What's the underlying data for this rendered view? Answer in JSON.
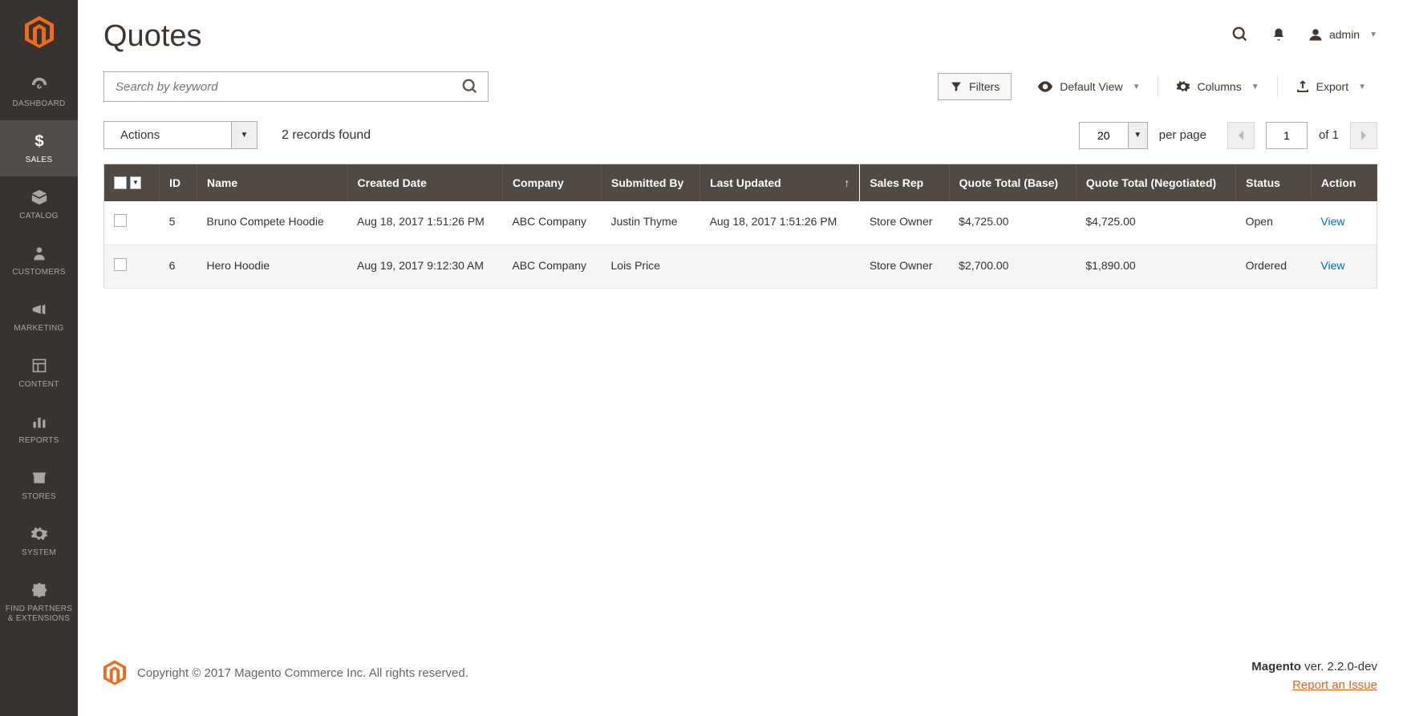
{
  "header": {
    "title": "Quotes",
    "user_label": "admin"
  },
  "sidebar": {
    "items": [
      {
        "label": "DASHBOARD"
      },
      {
        "label": "SALES"
      },
      {
        "label": "CATALOG"
      },
      {
        "label": "CUSTOMERS"
      },
      {
        "label": "MARKETING"
      },
      {
        "label": "CONTENT"
      },
      {
        "label": "REPORTS"
      },
      {
        "label": "STORES"
      },
      {
        "label": "SYSTEM"
      },
      {
        "label": "FIND PARTNERS & EXTENSIONS"
      }
    ]
  },
  "search": {
    "placeholder": "Search by keyword"
  },
  "controls": {
    "filters": "Filters",
    "default_view": "Default View",
    "columns": "Columns",
    "export": "Export"
  },
  "actions": {
    "label": "Actions"
  },
  "records_found": "2 records found",
  "pagination": {
    "per_page_value": "20",
    "per_page_label": "per page",
    "page_value": "1",
    "of_label": "of 1"
  },
  "table": {
    "headers": {
      "id": "ID",
      "name": "Name",
      "created": "Created Date",
      "company": "Company",
      "submitted": "Submitted By",
      "updated": "Last Updated",
      "sales_rep": "Sales Rep",
      "total_base": "Quote Total (Base)",
      "total_neg": "Quote Total (Negotiated)",
      "status": "Status",
      "action": "Action"
    },
    "rows": [
      {
        "id": "5",
        "name": "Bruno Compete Hoodie",
        "created": "Aug 18, 2017 1:51:26 PM",
        "company": "ABC Company",
        "submitted": "Justin Thyme",
        "updated": "Aug 18, 2017 1:51:26 PM",
        "sales_rep": "Store Owner",
        "total_base": "$4,725.00",
        "total_neg": "$4,725.00",
        "status": "Open",
        "action": "View"
      },
      {
        "id": "6",
        "name": "Hero Hoodie",
        "created": "Aug 19, 2017 9:12:30 AM",
        "company": "ABC Company",
        "submitted": "Lois Price",
        "updated": "",
        "sales_rep": "Store Owner",
        "total_base": "$2,700.00",
        "total_neg": "$1,890.00",
        "status": "Ordered",
        "action": "View"
      }
    ]
  },
  "footer": {
    "copyright": "Copyright © 2017 Magento Commerce Inc. All rights reserved.",
    "magento_label": "Magento",
    "version": " ver. 2.2.0-dev",
    "report": "Report an Issue"
  }
}
